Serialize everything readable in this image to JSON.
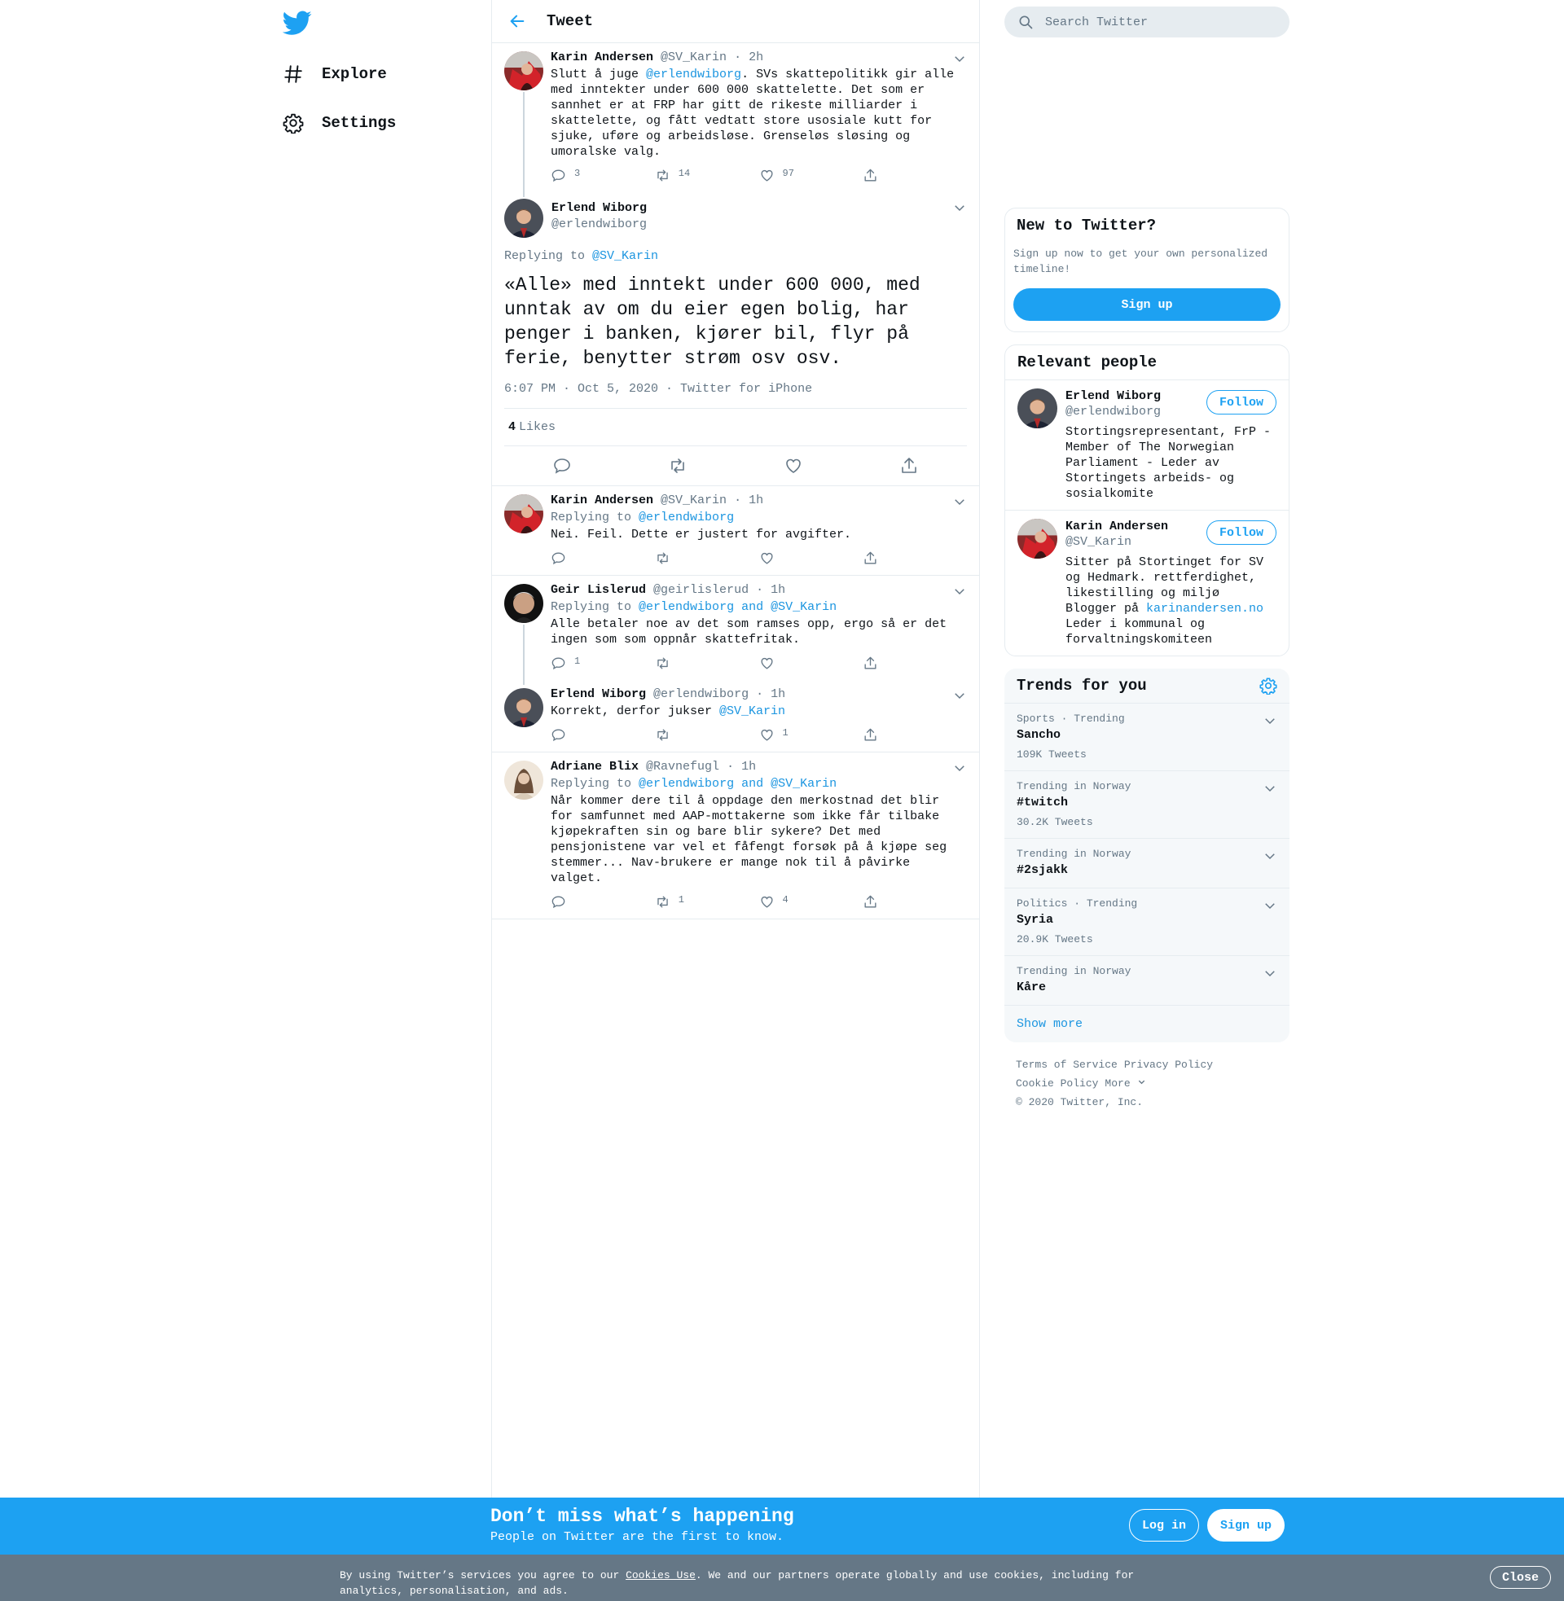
{
  "nav": {
    "logo_icon": "twitter-bird-icon",
    "items": [
      {
        "label": "Explore",
        "icon": "hashtag-icon"
      },
      {
        "label": "Settings",
        "icon": "gear-icon"
      }
    ]
  },
  "header": {
    "title": "Tweet",
    "back_icon": "arrow-left-icon"
  },
  "parent_tweet": {
    "name": "Karin Andersen",
    "handle": "@SV_Karin",
    "time": "2h",
    "text_before": "Slutt å juge ",
    "mention": "@erlendwiborg",
    "text_after": ". SVs skattepolitikk gir alle med inntekter under 600 000 skattelette. Det som er sannhet er at FRP har gitt de rikeste milliarder i skattelette, og fått vedtatt store usosiale kutt for sjuke, uføre og arbeidsløse. Grenseløs sløsing og umoralske valg.",
    "replies": "3",
    "retweets": "14",
    "likes": "97"
  },
  "focused_tweet": {
    "name": "Erlend Wiborg",
    "handle": "@erlendwiborg",
    "replying_label": "Replying to",
    "replying_to": "@SV_Karin",
    "text": "«Alle» med inntekt under 600 000, med unntak av om du eier egen bolig, har penger i banken, kjører bil, flyr på ferie, benytter strøm osv osv.",
    "timestamp": "6:07 PM · Oct 5, 2020",
    "source": "Twitter for iPhone",
    "likes_count": "4",
    "likes_label": "Likes"
  },
  "replies": [
    {
      "name": "Karin Andersen",
      "handle": "@SV_Karin",
      "time": "1h",
      "replying_label": "Replying to",
      "replying_to": "@erlendwiborg",
      "replying_and": "",
      "replying_to2": "",
      "text_before": "Nei. Feil. Dette er justert for avgifter.",
      "mention": "",
      "text_after": "",
      "replies": "",
      "retweets": "",
      "likes": ""
    },
    {
      "name": "Geir Lislerud",
      "handle": "@geirlislerud",
      "time": "1h",
      "replying_label": "Replying to",
      "replying_to": "@erlendwiborg",
      "replying_and": "and",
      "replying_to2": "@SV_Karin",
      "text_before": "Alle betaler noe av det som ramses opp, ergo så er det ingen som som oppnår skattefritak.",
      "mention": "",
      "text_after": "",
      "replies": "1",
      "retweets": "",
      "likes": ""
    },
    {
      "name": "Erlend Wiborg",
      "handle": "@erlendwiborg",
      "time": "1h",
      "replying_label": "",
      "replying_to": "",
      "replying_and": "",
      "replying_to2": "",
      "text_before": "Korrekt, derfor jukser ",
      "mention": "@SV_Karin",
      "text_after": "",
      "replies": "",
      "retweets": "",
      "likes": "1"
    },
    {
      "name": "Adriane Blix",
      "handle": "@Ravnefugl",
      "time": "1h",
      "replying_label": "Replying to",
      "replying_to": "@erlendwiborg",
      "replying_and": "and",
      "replying_to2": "@SV_Karin",
      "text_before": "Når kommer dere til å oppdage den merkostnad det blir for samfunnet med AAP-mottakerne som ikke får tilbake kjøpekraften sin og bare blir sykere? Det med pensjonistene var vel et fåfengt forsøk på å kjøpe seg stemmer... Nav-brukere er mange nok til å påvirke valget.",
      "mention": "",
      "text_after": "",
      "replies": "",
      "retweets": "1",
      "likes": "4"
    }
  ],
  "search": {
    "placeholder": "Search Twitter"
  },
  "new_to_twitter": {
    "title": "New to Twitter?",
    "description": "Sign up now to get your own personalized timeline!",
    "button": "Sign up"
  },
  "relevant_people": {
    "title": "Relevant people",
    "people": [
      {
        "name": "Erlend Wiborg",
        "handle": "@erlendwiborg",
        "follow": "Follow",
        "bio_before": "Stortingsrepresentant, FrP - Member of The Norwegian Parliament - Leder av Stortingets arbeids- og sosialkomite",
        "bio_link": "",
        "bio_after": ""
      },
      {
        "name": "Karin Andersen",
        "handle": "@SV_Karin",
        "follow": "Follow",
        "bio_before": "Sitter på Stortinget for SV og Hedmark. rettferdighet, likestilling og miljø Blogger på ",
        "bio_link": "karinandersen.no",
        "bio_after": " Leder i kommunal og forvaltningskomiteen"
      }
    ]
  },
  "trends": {
    "title": "Trends for you",
    "items": [
      {
        "context": "Sports · Trending",
        "name": "Sancho",
        "count": "109K Tweets"
      },
      {
        "context": "Trending in Norway",
        "name": "#twitch",
        "count": "30.2K Tweets"
      },
      {
        "context": "Trending in Norway",
        "name": "#2sjakk",
        "count": ""
      },
      {
        "context": "Politics · Trending",
        "name": "Syria",
        "count": "20.9K Tweets"
      },
      {
        "context": "Trending in Norway",
        "name": "Kåre",
        "count": ""
      }
    ],
    "show_more": "Show more"
  },
  "footer": {
    "terms": "Terms of Service",
    "privacy": "Privacy Policy",
    "cookie": "Cookie Policy",
    "more": "More",
    "copyright": "© 2020 Twitter, Inc."
  },
  "banner": {
    "title": "Don’t miss what’s happening",
    "subtitle": "People on Twitter are the first to know.",
    "login": "Log in",
    "signup": "Sign up"
  },
  "cookie_bar": {
    "text_before": "By using Twitter’s services you agree to our ",
    "link": "Cookies Use",
    "text_after": ". We and our partners operate globally and use cookies, including for analytics, personalisation, and ads.",
    "close": "Close"
  },
  "colors": {
    "accent": "#1da1f2",
    "link": "#1b95e0",
    "muted": "#657786",
    "border": "#e6ecf0"
  }
}
